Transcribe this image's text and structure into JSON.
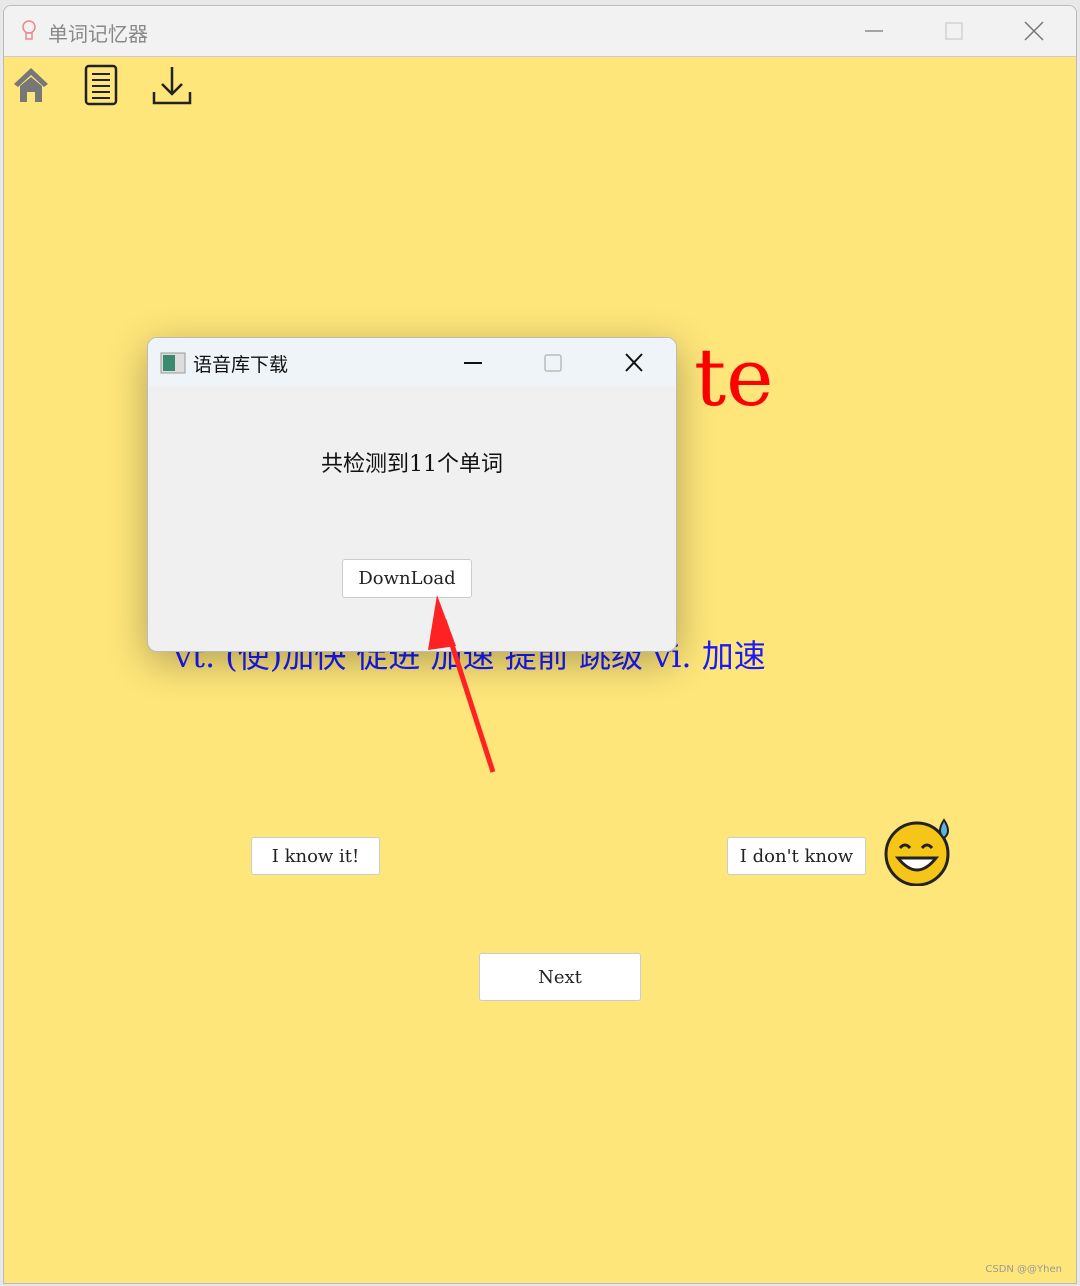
{
  "window": {
    "title": "单词记忆器"
  },
  "toolbar": {
    "icons": [
      "home-icon",
      "notebook-icon",
      "download-icon"
    ]
  },
  "card": {
    "word_visible": "te",
    "definition": "vt. (使)加快 促进 加速 提前 跳级 vi. 加速",
    "word_color": "#ff0000",
    "definition_color": "#1a1aff"
  },
  "buttons": {
    "know": "I know it!",
    "dont_know": "I don't know",
    "next": "Next"
  },
  "dialog": {
    "title": "语音库下载",
    "message": "共检测到11个单词",
    "download": "DownLoad"
  },
  "watermark": "CSDN @@Yhen",
  "colors": {
    "background": "#ffe67a"
  }
}
